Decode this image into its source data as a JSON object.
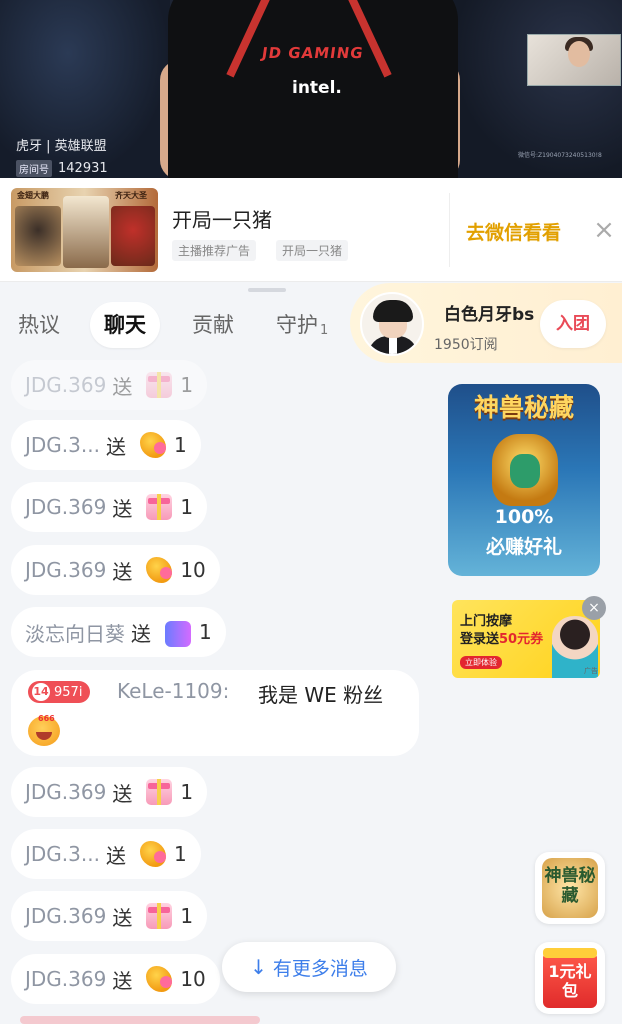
{
  "video": {
    "platform": "虎牙 | 英雄联盟",
    "room_label": "房间号",
    "room_number": "142931",
    "jersey_brand": "JD GAMING",
    "sponsor": "intel.",
    "corner_info": "微信号:Z19040732405130!8"
  },
  "ad": {
    "thumb_texts": [
      "金翅大鹏",
      "齐天大圣"
    ],
    "title": "开局一只猪",
    "tags": [
      "主播推荐广告",
      "开局一只猪"
    ],
    "cta": "去微信看看",
    "close": "×"
  },
  "tabs": [
    {
      "label": "热议"
    },
    {
      "label": "聊天"
    },
    {
      "label": "贡献"
    },
    {
      "label": "守护",
      "count": "1"
    }
  ],
  "anchor": {
    "name": "白色月牙bs",
    "subscribers": "1950订阅",
    "join": "入团"
  },
  "chat": [
    {
      "user": "JDG.369",
      "verb": "送",
      "gift": "gift-box-icon",
      "count": "1"
    },
    {
      "user": "JDG.3...",
      "verb": "送",
      "gift": "gift-dragon-icon",
      "count": "1"
    },
    {
      "user": "JDG.369",
      "verb": "送",
      "gift": "gift-box-icon",
      "count": "1"
    },
    {
      "user": "JDG.369",
      "verb": "送",
      "gift": "gift-dragon-icon",
      "count": "10"
    },
    {
      "user": "淡忘向日葵",
      "verb": "送",
      "gift": "fan-badge-icon",
      "count": "1"
    },
    {
      "user": "JDG.369",
      "verb": "送",
      "gift": "gift-box-icon",
      "count": "1"
    },
    {
      "user": "JDG.3...",
      "verb": "送",
      "gift": "gift-dragon-icon",
      "count": "1"
    },
    {
      "user": "JDG.369",
      "verb": "送",
      "gift": "gift-box-icon",
      "count": "1"
    },
    {
      "user": "JDG.369",
      "verb": "送",
      "gift": "gift-dragon-icon",
      "count": "10"
    }
  ],
  "chat_comment": {
    "level": "14",
    "fan_value": "957i",
    "user": "KeLe-1109:",
    "text": "我是 WE 粉丝",
    "emoji_tag": "666"
  },
  "more_messages": "有更多消息",
  "promos": {
    "beast_title": "神兽秘藏",
    "beast_line1": "100%",
    "beast_line2": "必赚好礼",
    "massage_line1": "上门按摩",
    "massage_line2_prefix": "登录送",
    "massage_line2_amount": "50元券",
    "massage_btn": "立即体验",
    "massage_ad": "广告",
    "fab_beast": "神兽秘藏",
    "fab_gift": "1元礼包"
  }
}
